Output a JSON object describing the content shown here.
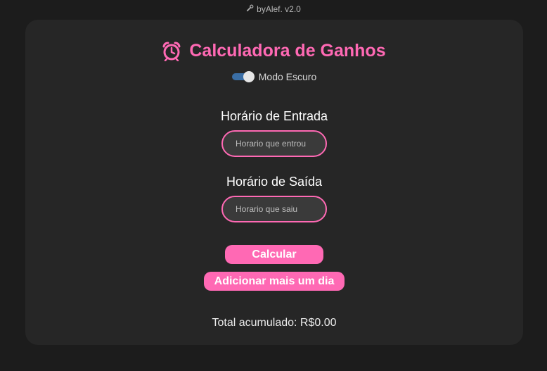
{
  "byline": {
    "icon": "wrench-icon",
    "text": "byAlef. v2.0"
  },
  "header": {
    "icon": "alarm-clock-icon",
    "title": "Calculadora de Ganhos",
    "accent_color": "#ff69b4"
  },
  "dark_mode": {
    "label": "Modo Escuro",
    "enabled": true
  },
  "form": {
    "entry": {
      "label": "Horário de Entrada",
      "placeholder": "Horario que entrou",
      "value": ""
    },
    "exit": {
      "label": "Horário de Saída",
      "placeholder": "Horario que saiu",
      "value": ""
    }
  },
  "actions": {
    "calculate_label": "Calcular",
    "add_day_label": "Adicionar mais um dia"
  },
  "summary": {
    "total_text": "Total acumulado: R$0.00"
  }
}
